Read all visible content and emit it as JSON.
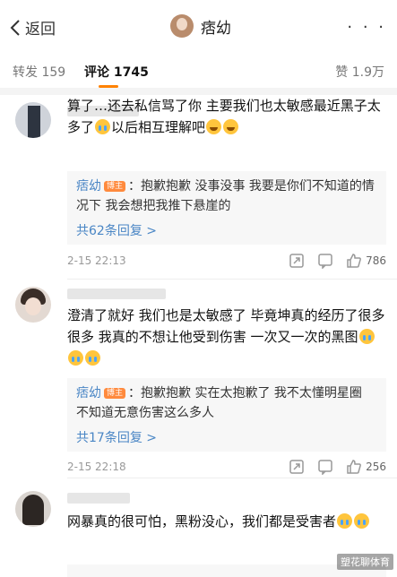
{
  "header": {
    "back_label": "返回",
    "title": "痞幼",
    "more": "· · ·"
  },
  "tabs": {
    "repost": "转发 159",
    "comments": "评论 1745",
    "likes": "赞 1.9万"
  },
  "comments": [
    {
      "text_a": "算了…还去私信骂了你 主要我们也太敏感最近黑子太多了",
      "text_b": "以后相互理解吧",
      "reply_name": "痞幼",
      "reply_badge": "博主",
      "reply_text": "抱歉抱歉 没事没事 我要是你们不知道的情况下 我会想把我推下悬崖的",
      "more_replies": "共62条回复 >",
      "time": "2-15 22:13",
      "likes": "786"
    },
    {
      "text_a": "澄清了就好 我们也是太敏感了 毕竟坤真的经历了很多很多 我真的不想让他受到伤害 一次又一次的黑图",
      "reply_name": "痞幼",
      "reply_badge": "博主",
      "reply_text": "抱歉抱歉 实在太抱歉了 我不太懂明星圈 不知道无意伤害这么多人",
      "more_replies": "共17条回复 >",
      "time": "2-15 22:18",
      "likes": "256"
    },
    {
      "text_a": "网暴真的很可怕，黑粉没心，我们都是受害者"
    }
  ],
  "watermark": "塑花聊体育",
  "colors": {
    "accent": "#ff8200",
    "link": "#4a86c5",
    "badge": "#ff8a3d"
  },
  "icons": [
    "chevron-left-icon",
    "share-icon",
    "comment-icon",
    "thumbs-up-icon",
    "crying-emoji-icon",
    "laughing-emoji-icon"
  ]
}
